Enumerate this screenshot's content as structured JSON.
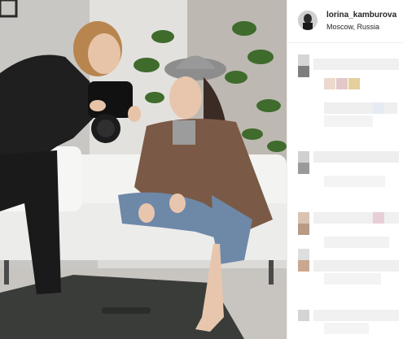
{
  "post": {
    "username": "lorina_kamburova",
    "location": "Moscow, Russia"
  },
  "photo": {
    "subject": "photo-shoot",
    "description_visible": false
  },
  "comments": {
    "pixelated": true
  },
  "colors": {
    "panel_bg": "#ffffff",
    "text": "#262626",
    "divider": "#efefef"
  },
  "icons": [
    "avatar-image"
  ]
}
